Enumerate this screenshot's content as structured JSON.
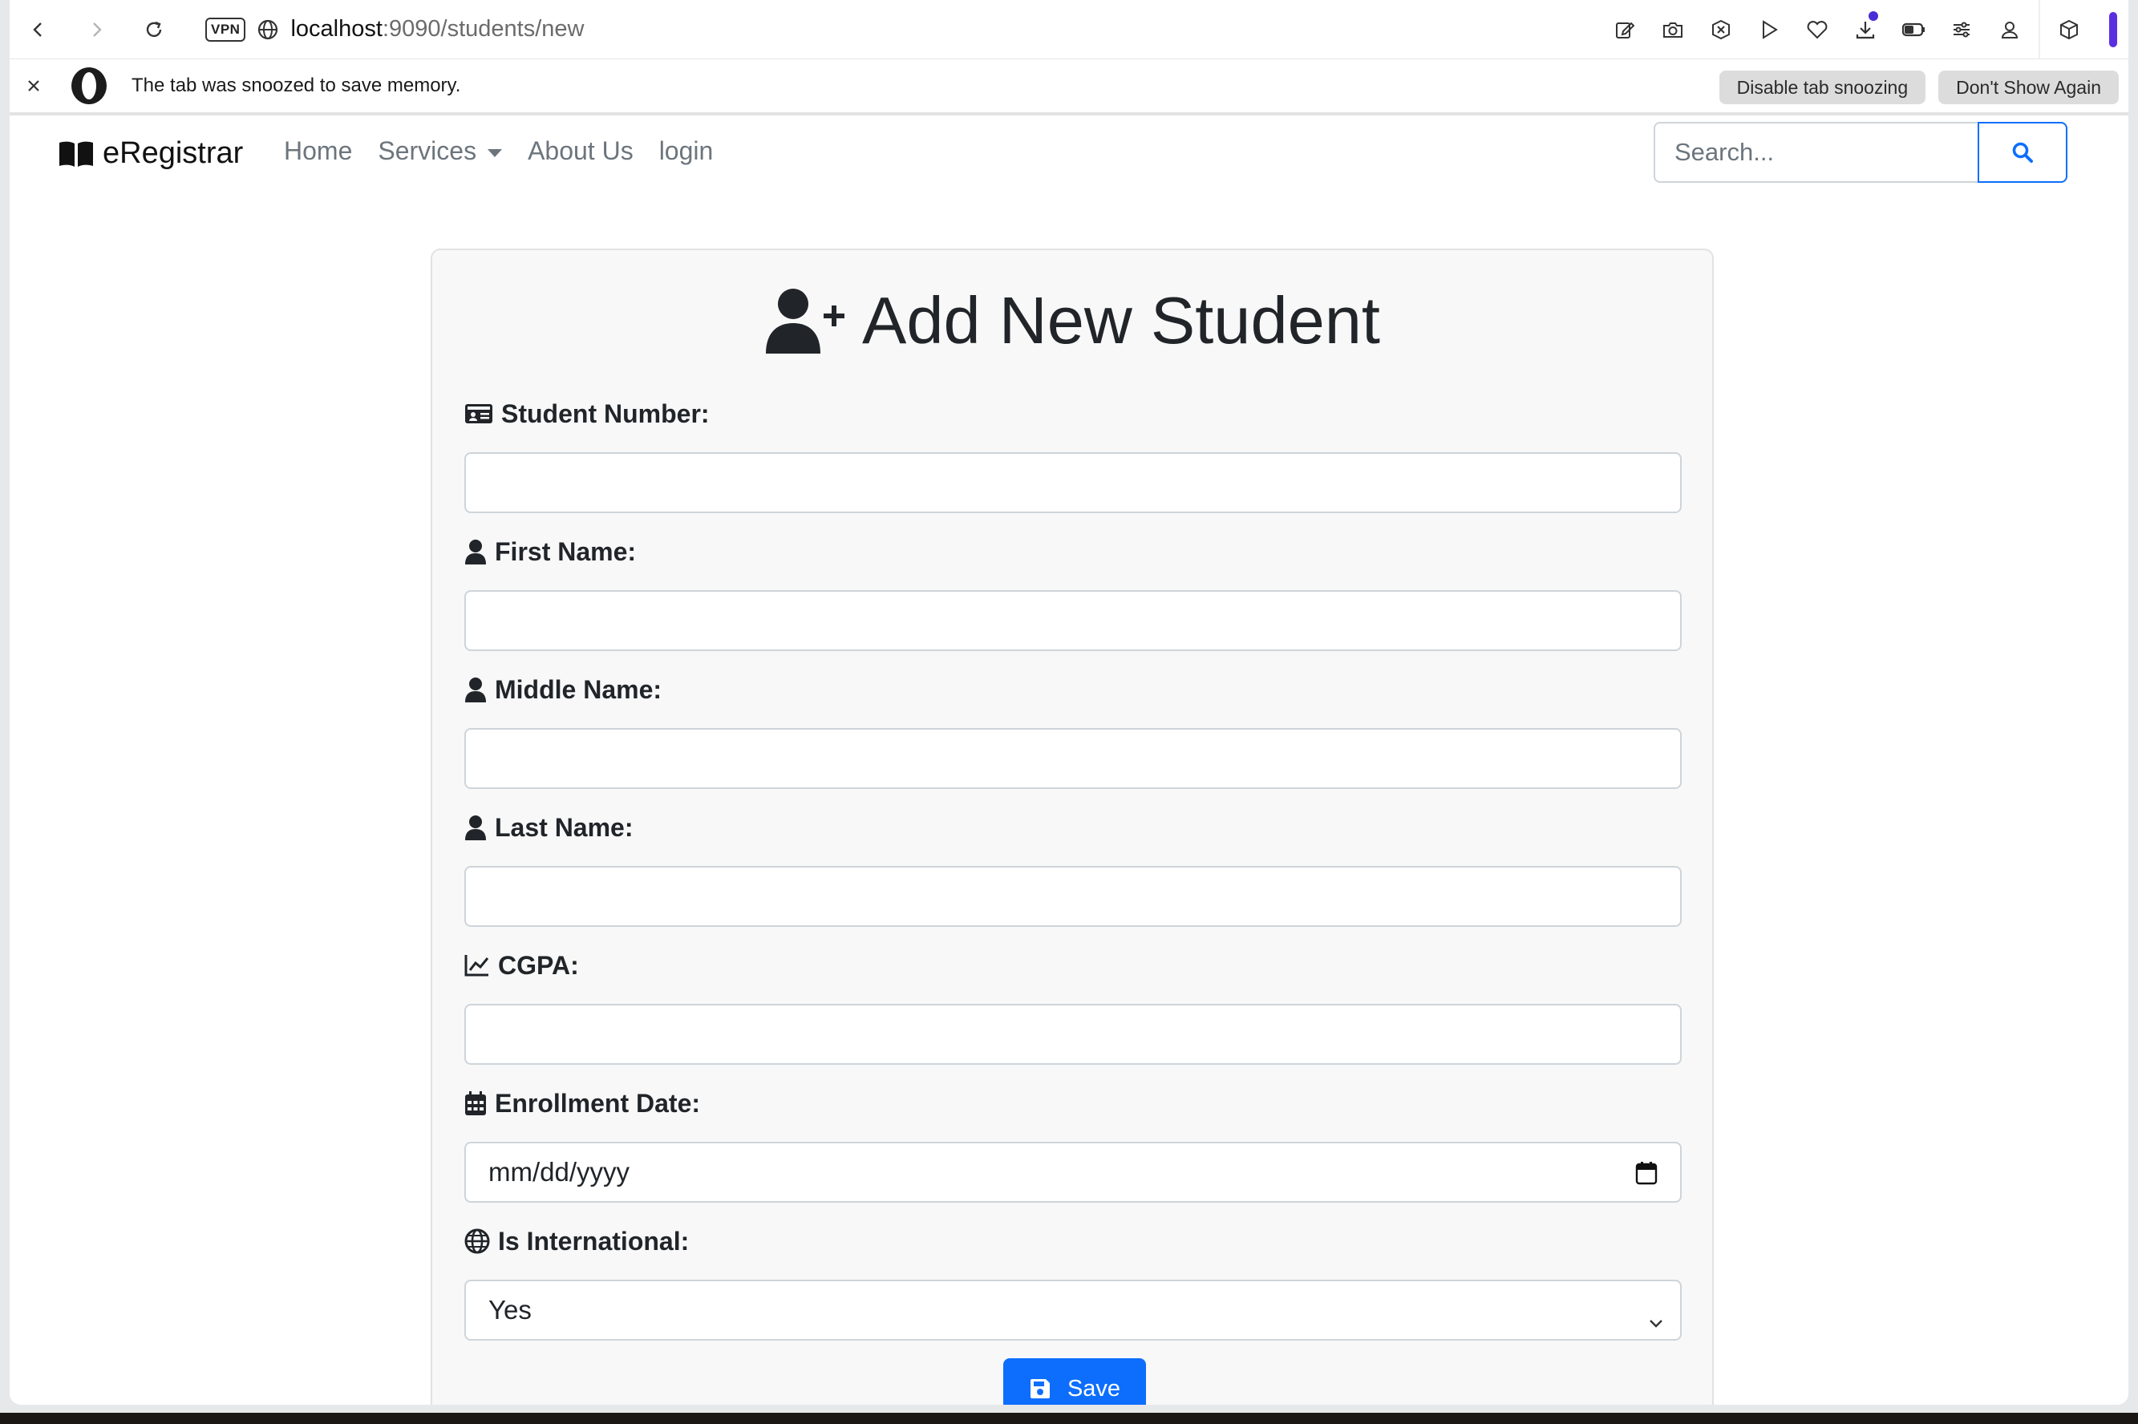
{
  "browser": {
    "vpn_label": "VPN",
    "url_host": "localhost",
    "url_rest": ":9090/students/new"
  },
  "snooze": {
    "message": "The tab was snoozed to save memory.",
    "disable_label": "Disable tab snoozing",
    "dismiss_label": "Don't Show Again"
  },
  "navbar": {
    "brand": "eRegistrar",
    "links": [
      "Home",
      "Services",
      "About Us",
      "login"
    ],
    "search_placeholder": "Search..."
  },
  "form": {
    "title": "Add New Student",
    "fields": [
      {
        "label": "Student Number:",
        "icon": "id-card-icon",
        "value": ""
      },
      {
        "label": "First Name:",
        "icon": "user-icon",
        "value": ""
      },
      {
        "label": "Middle Name:",
        "icon": "user-icon",
        "value": ""
      },
      {
        "label": "Last Name:",
        "icon": "user-icon",
        "value": ""
      },
      {
        "label": "CGPA:",
        "icon": "chart-line-icon",
        "value": ""
      },
      {
        "label": "Enrollment Date:",
        "icon": "calendar-icon",
        "value": "mm/dd/yyyy"
      },
      {
        "label": "Is International:",
        "icon": "globe-icon",
        "value": "Yes"
      }
    ],
    "save_label": "Save"
  },
  "colors": {
    "primary": "#0d6efd",
    "accent": "#5b2fe0"
  }
}
